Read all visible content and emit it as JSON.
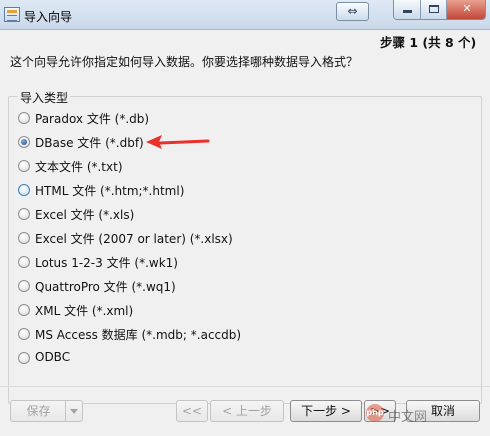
{
  "window": {
    "title": "导入向导",
    "restore_glyph": "⇔",
    "close_glyph": "✕"
  },
  "step": "步骤 1 (共 8 个)",
  "description": "这个向导允许你指定如何导入数据。你要选择哪种数据导入格式？",
  "group_title": "导入类型",
  "options": [
    {
      "label": "Paradox 文件 (*.db)",
      "selected": false
    },
    {
      "label": "DBase 文件 (*.dbf)",
      "selected": true
    },
    {
      "label": "文本文件 (*.txt)",
      "selected": false
    },
    {
      "label": "HTML 文件 (*.htm;*.html)",
      "selected": false
    },
    {
      "label": "Excel 文件 (*.xls)",
      "selected": false
    },
    {
      "label": "Excel 文件 (2007 or later) (*.xlsx)",
      "selected": false
    },
    {
      "label": "Lotus 1-2-3 文件 (*.wk1)",
      "selected": false
    },
    {
      "label": "QuattroPro 文件 (*.wq1)",
      "selected": false
    },
    {
      "label": "XML 文件 (*.xml)",
      "selected": false
    },
    {
      "label": "MS Access 数据库 (*.mdb; *.accdb)",
      "selected": false
    },
    {
      "label": "ODBC",
      "selected": false
    }
  ],
  "buttons": {
    "save": "保存",
    "first": "<<",
    "prev": "< 上一步",
    "next": "下一步 >",
    "last": ">>",
    "cancel": "取消"
  },
  "watermark": "中文网",
  "watermark_logo": "php",
  "colors": {
    "arrow": "#e8322b",
    "selected_radio": "#1f4f8e",
    "close_button": "#c4473a"
  }
}
